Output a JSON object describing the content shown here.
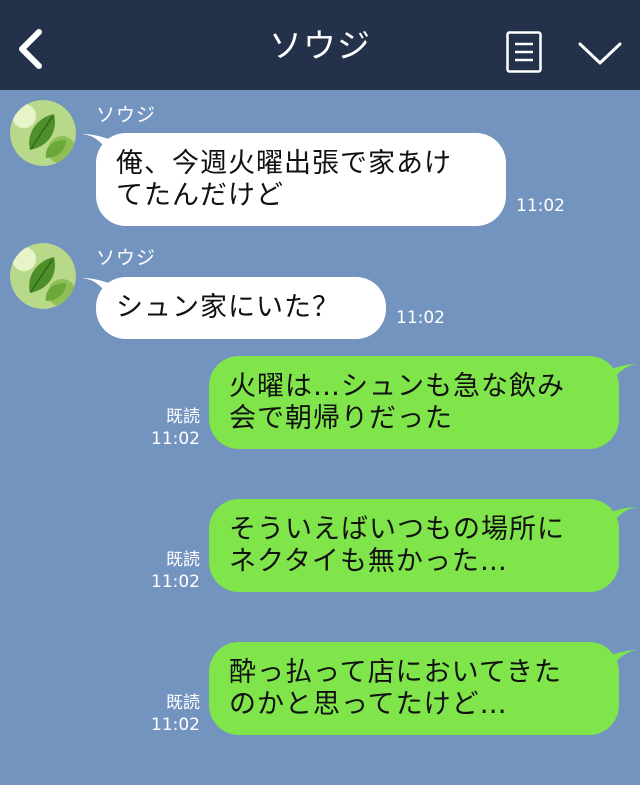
{
  "header": {
    "title": "ソウジ",
    "back_icon": "chevron-left-icon",
    "menu_icon": "menu-icon",
    "collapse_icon": "chevron-down-icon"
  },
  "colors": {
    "header_bg": "#24314a",
    "chat_bg": "#7494c0",
    "received_bubble": "#ffffff",
    "sent_bubble": "#7fe54a"
  },
  "messages": [
    {
      "direction": "received",
      "sender": "ソウジ",
      "lines": [
        "俺、今週火曜出張で家あけ",
        "てたんだけど"
      ],
      "time": "11:02"
    },
    {
      "direction": "received",
      "sender": "ソウジ",
      "lines": [
        "シュン家にいた？"
      ],
      "time": "11:02"
    },
    {
      "direction": "sent",
      "read_label": "既読",
      "lines": [
        "火曜は…シュンも急な飲み",
        "会で朝帰りだった"
      ],
      "time": "11:02"
    },
    {
      "direction": "sent",
      "read_label": "既読",
      "lines": [
        "そういえばいつもの場所に",
        "ネクタイも無かった…"
      ],
      "time": "11:02"
    },
    {
      "direction": "sent",
      "read_label": "既読",
      "lines": [
        "酔っ払って店においてきた",
        "のかと思ってたけど…"
      ],
      "time": "11:02"
    }
  ]
}
